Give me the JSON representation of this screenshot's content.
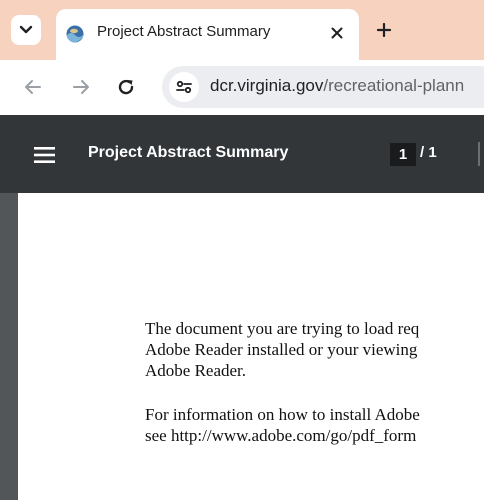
{
  "browser": {
    "tab": {
      "title": "Project Abstract Summary",
      "favicon": "globe-favicon-icon"
    },
    "icons": {
      "tab_search": "chevron-down-icon",
      "close": "close-icon",
      "new_tab": "plus-icon",
      "back": "back-arrow-icon",
      "forward": "forward-arrow-icon",
      "reload": "reload-icon",
      "site_info": "tune-icon"
    },
    "address_bar": {
      "domain": "dcr.virginia.gov",
      "path": "/recreational-plann"
    },
    "colors": {
      "tab_strip": "#f7d3bf",
      "omnibox": "#ecedf1"
    }
  },
  "pdf_viewer": {
    "title": "Project Abstract Summary",
    "current_page": "1",
    "page_separator": "/ 1",
    "icons": {
      "menu": "hamburger-menu-icon"
    },
    "colors": {
      "toolbar": "#323639",
      "background": "#525659"
    }
  },
  "document": {
    "lines": [
      "The document you are trying to load req",
      "Adobe Reader installed or your viewing",
      "Adobe Reader.",
      "For information on how to install Adobe",
      "see  http://www.adobe.com/go/pdf_form"
    ]
  }
}
